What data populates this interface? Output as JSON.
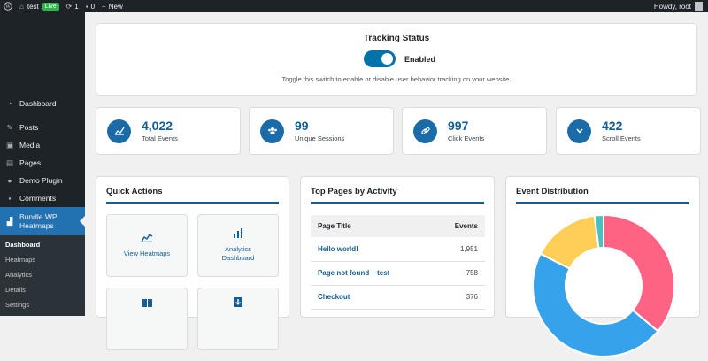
{
  "adminbar": {
    "site_name": "test",
    "live_badge": "Live",
    "updates_count": "1",
    "comments_count": "0",
    "new_label": "New",
    "howdy": "Howdy, root"
  },
  "sidebar": {
    "items": [
      {
        "label": "Dashboard",
        "icon": "dashboard-icon"
      },
      {
        "label": "Posts",
        "icon": "pin-icon"
      },
      {
        "label": "Media",
        "icon": "media-icon"
      },
      {
        "label": "Pages",
        "icon": "pages-icon"
      },
      {
        "label": "Demo Plugin",
        "icon": "plugin-icon"
      },
      {
        "label": "Comments",
        "icon": "comment-icon"
      },
      {
        "label": "Bundle WP Heatmaps",
        "icon": "chart-icon"
      }
    ],
    "submenu": [
      "Dashboard",
      "Heatmaps",
      "Analytics",
      "Details",
      "Settings"
    ]
  },
  "tracking": {
    "title": "Tracking Status",
    "toggle_label": "Enabled",
    "toggle_on": true,
    "description": "Toggle this switch to enable or disable user behavior tracking on your website."
  },
  "stats": [
    {
      "value": "4,022",
      "label": "Total Events",
      "icon": "chart-icon"
    },
    {
      "value": "99",
      "label": "Unique Sessions",
      "icon": "users-icon"
    },
    {
      "value": "997",
      "label": "Click Events",
      "icon": "link-icon"
    },
    {
      "value": "422",
      "label": "Scroll Events",
      "icon": "chevron-down-icon"
    }
  ],
  "quick_actions": {
    "title": "Quick Actions",
    "buttons": [
      {
        "label": "View Heatmaps",
        "icon": "heatmap-icon"
      },
      {
        "label": "Analytics Dashboard",
        "icon": "bar-chart-icon"
      },
      {
        "label": "",
        "icon": "grid-icon"
      },
      {
        "label": "",
        "icon": "download-icon"
      }
    ]
  },
  "top_pages": {
    "title": "Top Pages by Activity",
    "col_page": "Page Title",
    "col_events": "Events",
    "rows": [
      {
        "page": "Hello world!",
        "events": "1,951"
      },
      {
        "page": "Page not found – test",
        "events": "758"
      },
      {
        "page": "Checkout",
        "events": "376"
      }
    ]
  },
  "event_distribution": {
    "title": "Event Distribution"
  },
  "chart_data": {
    "type": "pie",
    "donut": true,
    "categories": [
      "Pink",
      "Blue",
      "Yellow",
      "Teal"
    ],
    "values": [
      35,
      45,
      15,
      2
    ],
    "colors": [
      "#ff6384",
      "#36a2eb",
      "#ffce56",
      "#4bc0c0"
    ]
  }
}
